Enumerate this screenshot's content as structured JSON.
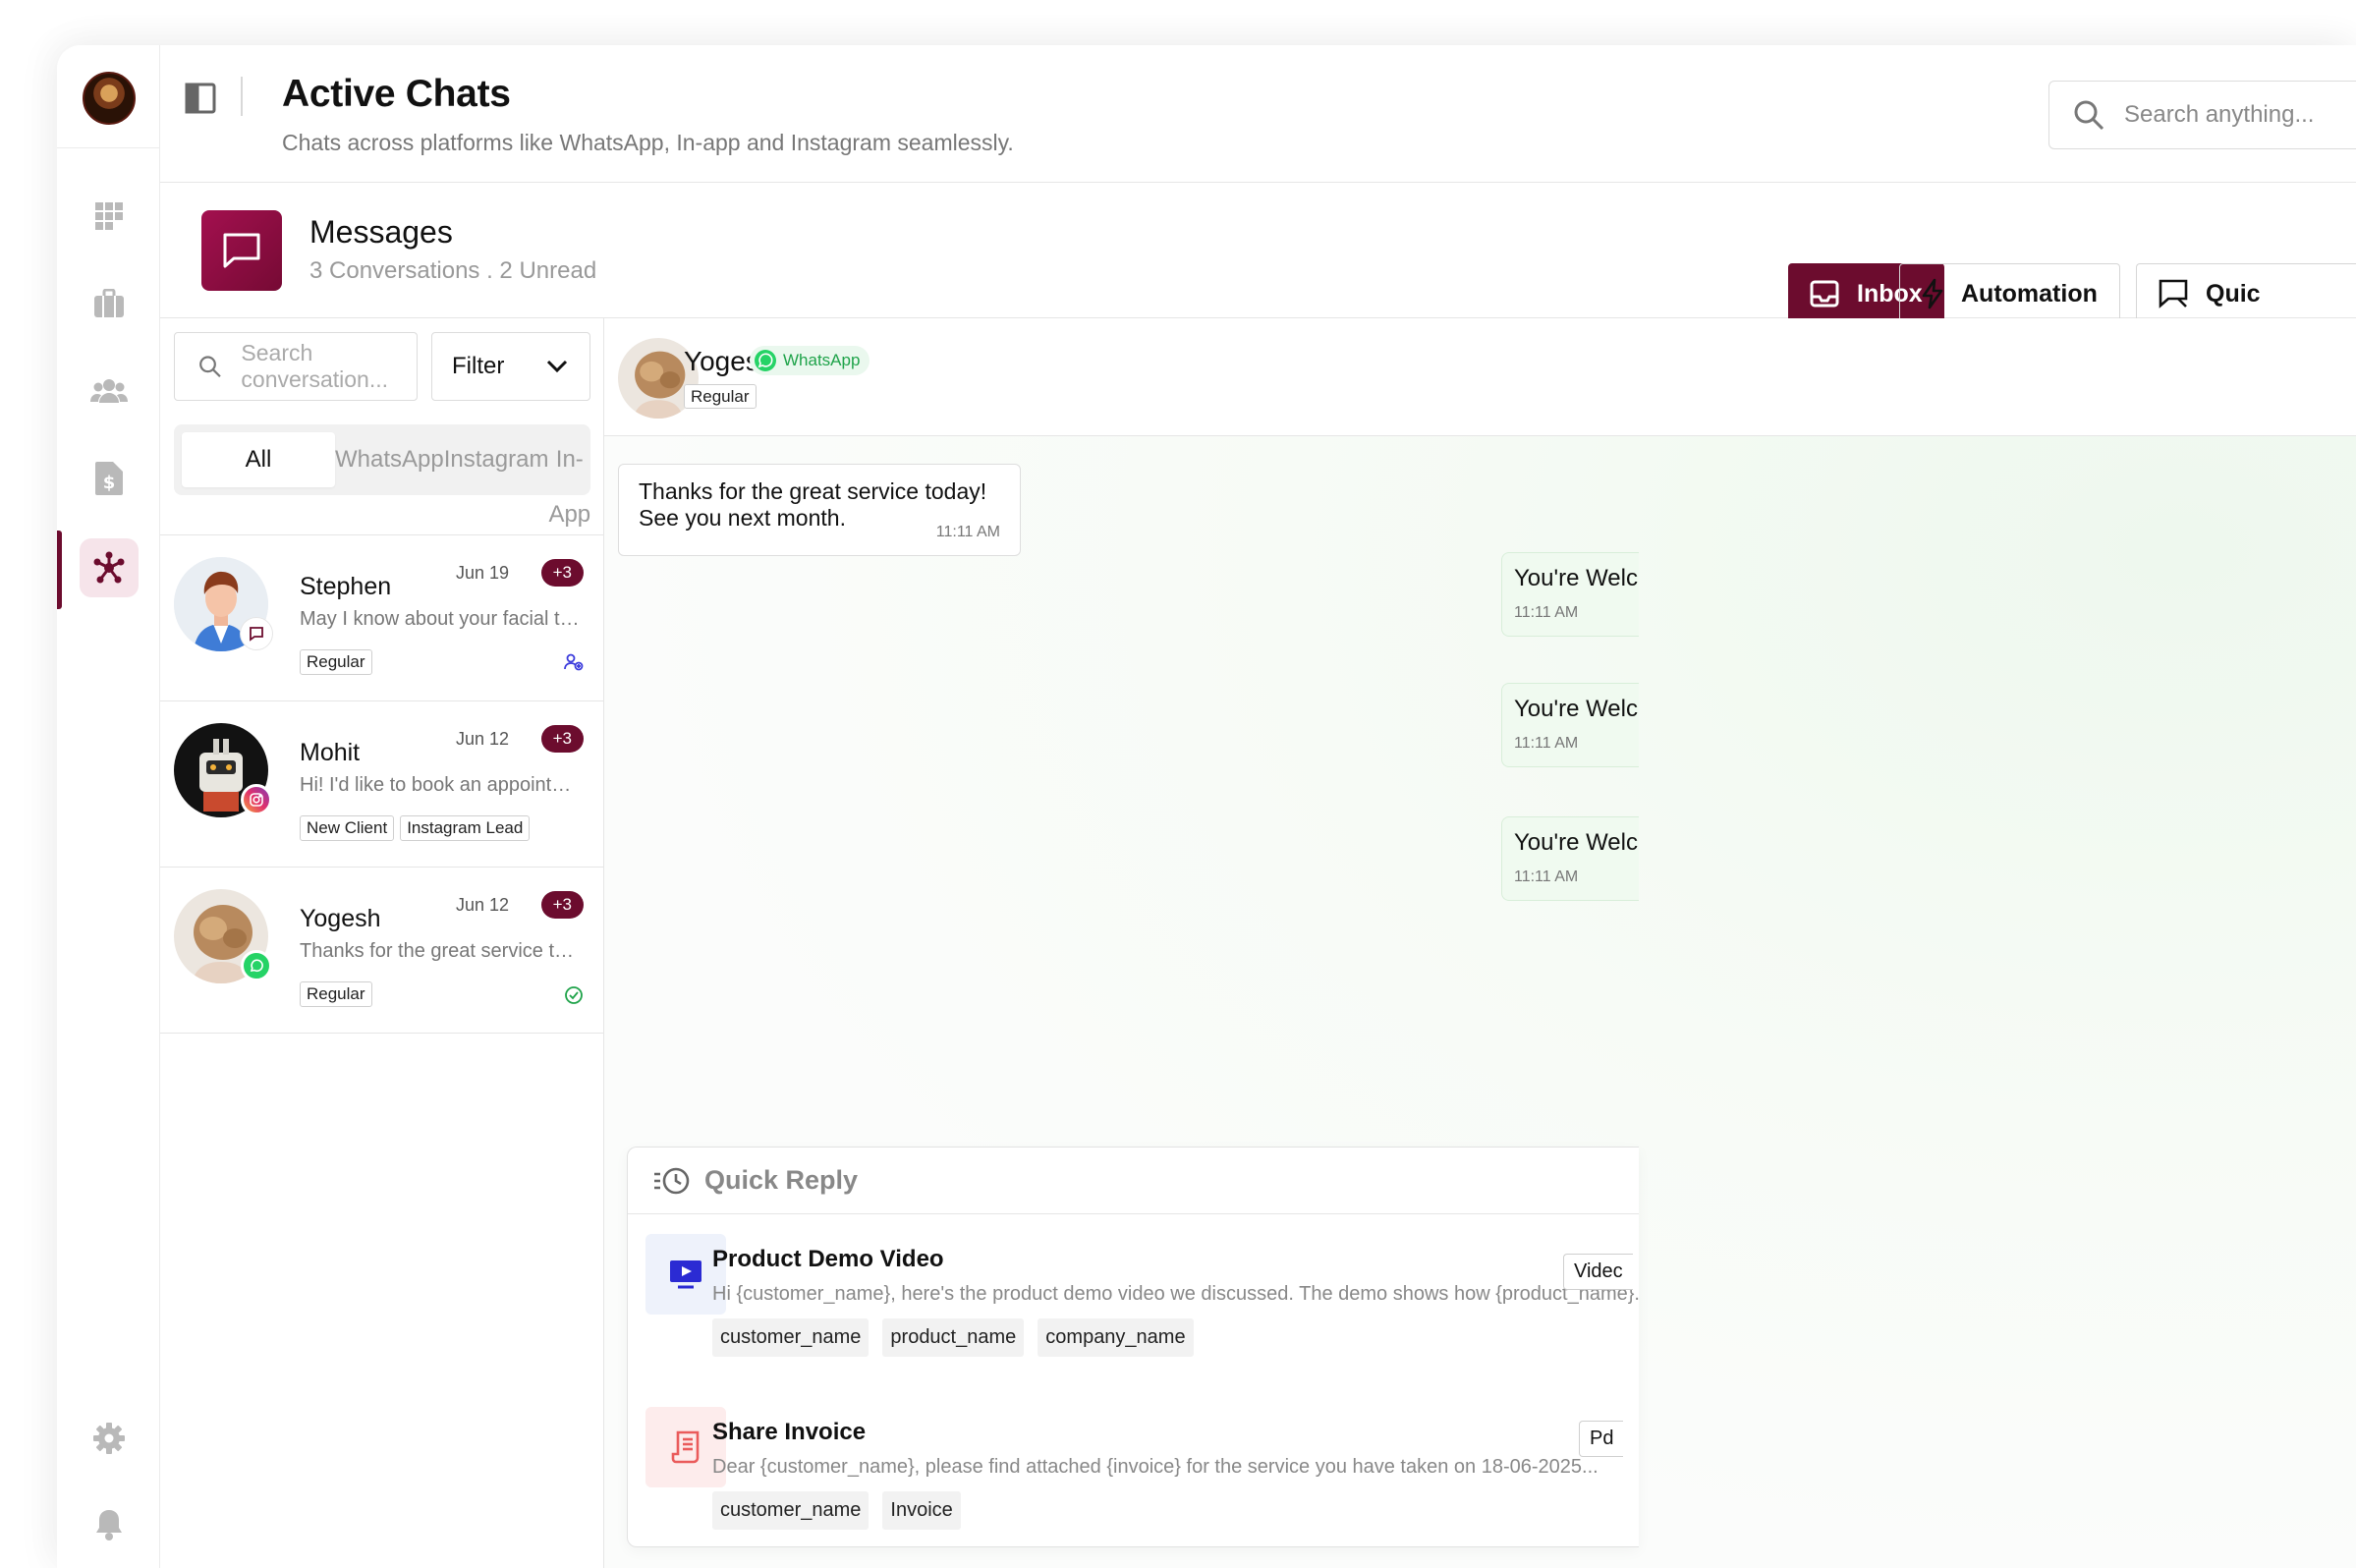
{
  "header": {
    "title": "Active Chats",
    "subtitle": "Chats across platforms like WhatsApp, In-app and Instagram seamlessly.",
    "search_placeholder": "Search anything..."
  },
  "messages_bar": {
    "title": "Messages",
    "subtitle": "3 Conversations . 2 Unread",
    "buttons": {
      "inbox": "Inbox",
      "automation": "Automation",
      "quick": "Quic"
    }
  },
  "conversation_list": {
    "search_placeholder": "Search conversation...",
    "filter_label": "Filter",
    "tabs": [
      "All",
      "WhatsApp",
      "Instagram",
      "In-App"
    ],
    "items": [
      {
        "name": "Stephen",
        "date": "Jun 19",
        "unread": "+3",
        "preview": "May I know about your facial treatment options and woul...",
        "tags": [
          "Regular"
        ]
      },
      {
        "name": "Mohit",
        "date": "Jun 12",
        "unread": "+3",
        "preview": "Hi! I'd like to book an appointment for this Facial and nail...",
        "tags": [
          "New Client",
          "Instagram Lead"
        ]
      },
      {
        "name": "Yogesh",
        "date": "Jun 12",
        "unread": "+3",
        "preview": "Thanks for the great service today! See you next time, un...",
        "tags": [
          "Regular"
        ]
      }
    ]
  },
  "chat": {
    "contact_name": "Yogesh",
    "channel": "WhatsApp",
    "tag": "Regular",
    "messages": [
      {
        "text": "Thanks for the great service today! See you next month.",
        "time": "11:11 AM"
      },
      {
        "text": "You're Welc",
        "time": "11:11 AM"
      },
      {
        "text": "You're Welc",
        "time": "11:11 AM"
      },
      {
        "text": "You're Welc",
        "time": "11:11 AM"
      }
    ]
  },
  "quick_reply": {
    "title": "Quick Reply",
    "items": [
      {
        "title": "Product Demo Video",
        "desc": "Hi {customer_name}, here's the product demo video we discussed. The demo shows how {product_name}...",
        "vars": [
          "customer_name",
          "product_name",
          "company_name"
        ],
        "type": "Videc"
      },
      {
        "title": "Share Invoice",
        "desc": "Dear {customer_name}, please find attached {invoice} for the service you have taken on 18-06-2025...",
        "vars": [
          "customer_name",
          "Invoice"
        ],
        "type": "Pd"
      }
    ]
  },
  "colors": {
    "brand": "#6c0c2e",
    "whatsapp": "#25d366",
    "accent_blue": "#3b3bdc"
  }
}
